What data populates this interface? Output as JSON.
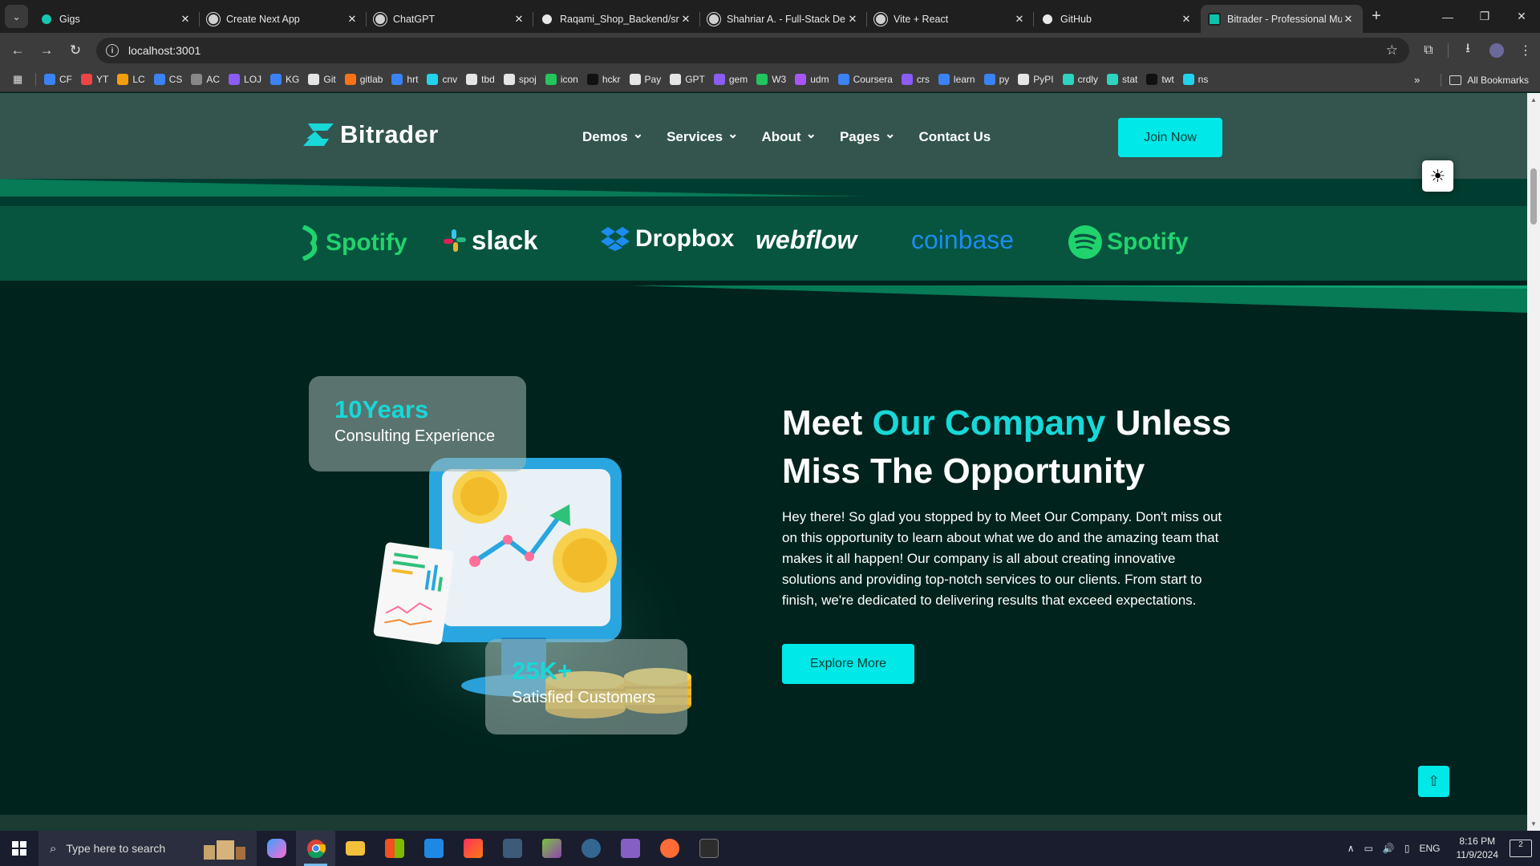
{
  "browser": {
    "tabs": [
      {
        "title": "Gigs",
        "favicon": "fiverr-icon"
      },
      {
        "title": "Create Next App",
        "favicon": "globe-icon"
      },
      {
        "title": "ChatGPT",
        "favicon": "openai-icon"
      },
      {
        "title": "Raqami_Shop_Backend/sr",
        "favicon": "github-icon"
      },
      {
        "title": "Shahriar A. - Full-Stack De",
        "favicon": "upwork-icon"
      },
      {
        "title": "Vite + React",
        "favicon": "globe-icon"
      },
      {
        "title": "GitHub",
        "favicon": "github-icon"
      },
      {
        "title": "Bitrader - Professional Mu",
        "favicon": "bitrader-icon",
        "active": true
      }
    ],
    "address": "localhost:3001",
    "bookmarks": [
      "CF",
      "YT",
      "LC",
      "CS",
      "AC",
      "LOJ",
      "KG",
      "Git",
      "gitlab",
      "hrt",
      "cnv",
      "tbd",
      "spoj",
      "icon",
      "hckr",
      "Pay",
      "GPT",
      "gem",
      "W3",
      "udm",
      "Coursera",
      "crs",
      "learn",
      "py",
      "PyPI",
      "crdly",
      "stat",
      "twt",
      "ns"
    ],
    "bookmark_colors": [
      "#3b82f6",
      "#ef4444",
      "#f59e0b",
      "#3b82f6",
      "#888888",
      "#8b5cf6",
      "#3b82f6",
      "#e5e5e5",
      "#f97316",
      "#3b82f6",
      "#22d3ee",
      "#e5e5e5",
      "#e5e5e5",
      "#22c55e",
      "#111111",
      "#e5e5e5",
      "#e5e5e5",
      "#8b5cf6",
      "#22c55e",
      "#a855f7",
      "#3b82f6",
      "#8b5cf6",
      "#3b82f6",
      "#3b82f6",
      "#e5e5e5",
      "#2dd4bf",
      "#2dd4bf",
      "#111111",
      "#22d3ee"
    ],
    "all_bookmarks_label": "All Bookmarks"
  },
  "site": {
    "brand": "Bitrader",
    "nav": [
      {
        "label": "Demos",
        "dropdown": true
      },
      {
        "label": "Services",
        "dropdown": true
      },
      {
        "label": "About",
        "dropdown": true
      },
      {
        "label": "Pages",
        "dropdown": true
      },
      {
        "label": "Contact Us",
        "dropdown": false
      }
    ],
    "join_label": "Join Now",
    "partners": [
      "Spotify",
      "slack",
      "Dropbox",
      "webflow",
      "coinbase",
      "Spotify"
    ],
    "badges": {
      "years_value": "10Years",
      "years_label": "Consulting Experience",
      "customers_value": "25K+",
      "customers_label": "Satisfied Customers"
    },
    "heading": {
      "part1": "Meet ",
      "highlight": "Our Company",
      "part2": " Unless Miss The Opportunity"
    },
    "description": "Hey there! So glad you stopped by to Meet Our Company. Don't miss out on this opportunity to learn about what we do and the amazing team that makes it all happen! Our company is all about creating innovative solutions and providing top-notch services to our clients. From start to finish, we're dedicated to delivering results that exceed expectations.",
    "explore_label": "Explore More",
    "colors": {
      "accent": "#00e8e8",
      "highlight": "#18d8d8",
      "background": "#00231d",
      "header": "#33554e",
      "brand_band": "#07553f",
      "partner_green": "#21d36d",
      "coinbase_blue": "#1c8cf0"
    }
  },
  "taskbar": {
    "search_placeholder": "Type here to search",
    "lang": "ENG",
    "time": "8:16 PM",
    "date": "11/9/2024",
    "notifications": "2"
  }
}
